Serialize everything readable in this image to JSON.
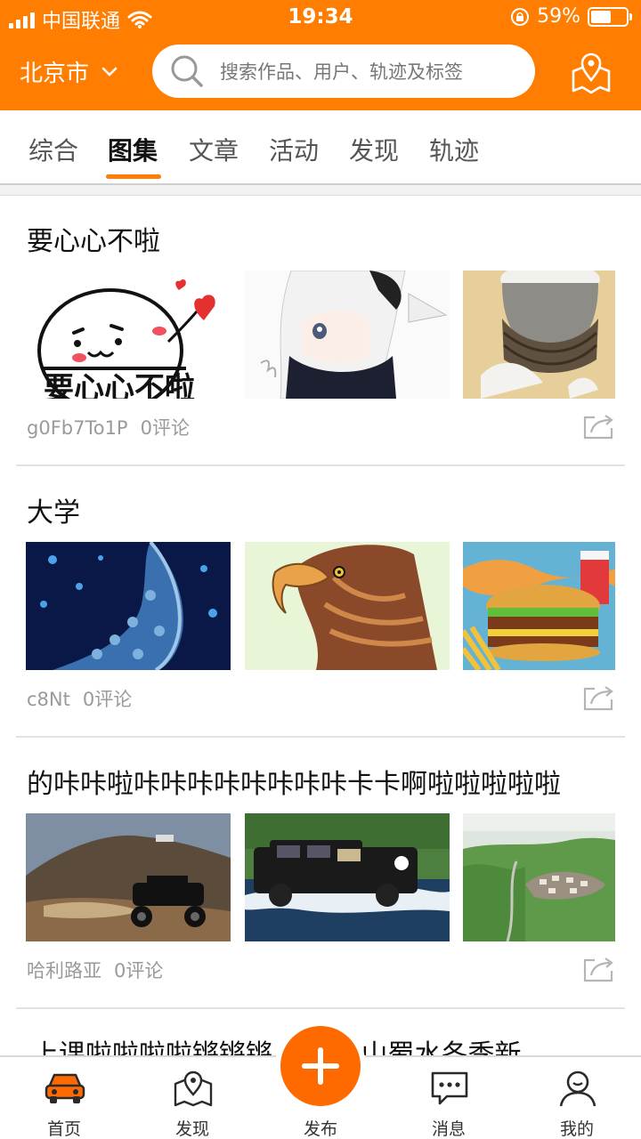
{
  "status_bar": {
    "carrier": "中国联通",
    "time": "19:34",
    "battery_percent": "59%",
    "battery_level": 0.59,
    "icons": [
      "signal-icon",
      "wifi-icon",
      "rotation-lock-icon",
      "battery-icon"
    ]
  },
  "header": {
    "city": "北京市",
    "search_placeholder": "搜索作品、用户、轨迹及标签",
    "map_button_icon": "map-pin-icon",
    "accent_color": "#ff7d00"
  },
  "tabs": [
    {
      "label": "综合",
      "active": false
    },
    {
      "label": "图集",
      "active": true
    },
    {
      "label": "文章",
      "active": false
    },
    {
      "label": "活动",
      "active": false
    },
    {
      "label": "发现",
      "active": false
    },
    {
      "label": "轨迹",
      "active": false
    }
  ],
  "feed": [
    {
      "title": "要心心不啦",
      "author": "g0Fb7To1P",
      "comments": "0评论",
      "images": [
        "meme-heart-sticker",
        "anime-girl-white-hair",
        "cat-rope-meme"
      ],
      "thumb_text": "要心心不啦"
    },
    {
      "title": "大学",
      "author": "c8Nt",
      "comments": "0评论",
      "images": [
        "blue-whale-pattern",
        "eagle-illustration",
        "burger-illustration"
      ]
    },
    {
      "title": "的咔咔啦咔咔咔咔咔咔咔咔卡卡啊啦啦啦啦啦",
      "author": "哈利路亚",
      "comments": "0评论",
      "images": [
        "offroad-buggy-photo",
        "jeep-river-photo",
        "mountain-town-photo"
      ]
    }
  ],
  "peek_title": "上课啦啦啦啦锵锵锵     我看巴山蜀水冬季新",
  "bottom_nav": [
    {
      "label": "首页",
      "icon": "car-icon",
      "active": true
    },
    {
      "label": "发现",
      "icon": "map-icon",
      "active": false
    },
    {
      "label": "发布",
      "icon": "plus-icon",
      "active": false
    },
    {
      "label": "消息",
      "icon": "message-icon",
      "active": false
    },
    {
      "label": "我的",
      "icon": "user-icon",
      "active": false
    }
  ]
}
